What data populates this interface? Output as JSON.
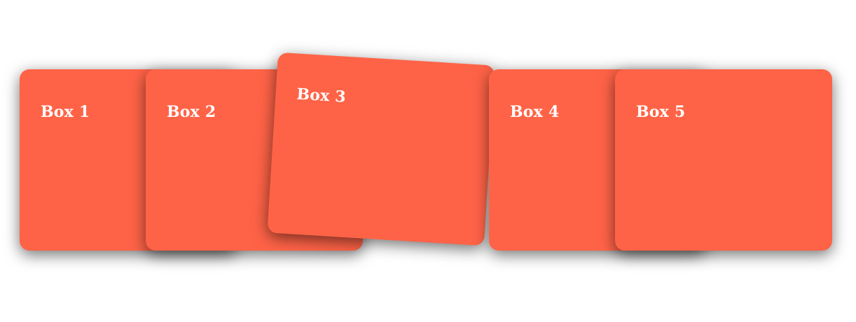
{
  "theme": {
    "box_color": "#ff6347",
    "text_color": "#ffffff",
    "background": "#ffffff"
  },
  "boxes": [
    {
      "label": "Box 1"
    },
    {
      "label": "Box 2"
    },
    {
      "label": "Box 3"
    },
    {
      "label": "Box 4"
    },
    {
      "label": "Box 5"
    }
  ]
}
